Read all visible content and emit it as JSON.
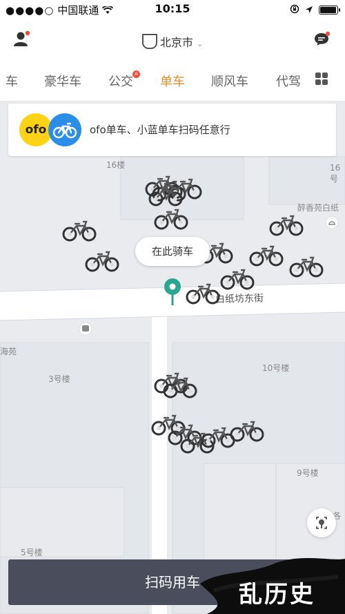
{
  "status": {
    "carrier": "中国联通",
    "time": "10:15"
  },
  "header": {
    "city": "北京市"
  },
  "tabs": [
    {
      "label": "车"
    },
    {
      "label": "豪华车"
    },
    {
      "label": "公交"
    },
    {
      "label": "单车",
      "active": true
    },
    {
      "label": "顺风车"
    },
    {
      "label": "代驾"
    }
  ],
  "banner": {
    "logo_text": "ofo",
    "text": "ofo单车、小蓝单车扫码任意行"
  },
  "map": {
    "labels": [
      "16楼",
      "16号",
      "醉香苑白纸",
      "海苑",
      "3号楼",
      "10号楼",
      "9号楼",
      "5号楼",
      "A各中"
    ],
    "road": "白纸坊东街"
  },
  "bubble": {
    "text": "在此骑车"
  },
  "scan_button": {
    "label": "扫码用车"
  },
  "watermark": {
    "text": "乱历史"
  },
  "colors": {
    "accent": "#f08a2a",
    "button": "#4a4d5c",
    "pin": "#2aa58f"
  }
}
